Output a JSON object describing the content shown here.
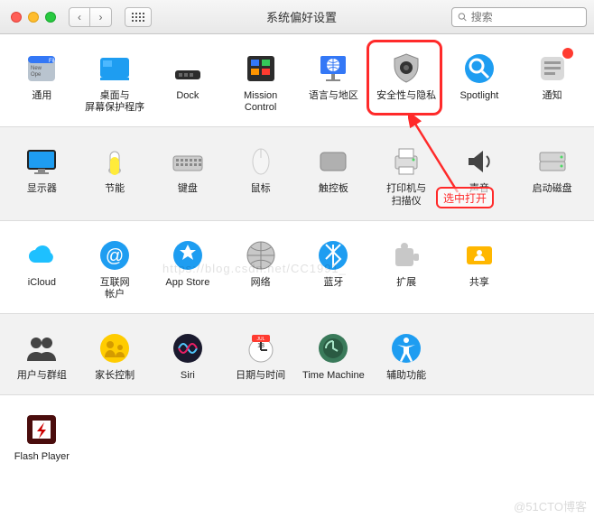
{
  "window": {
    "title": "系统偏好设置"
  },
  "search": {
    "placeholder": "搜索"
  },
  "annotation": {
    "callout": "选中打开"
  },
  "watermarks": {
    "center": "https://blog.csdn.net/CC1991_",
    "bottom": "@51CTO博客"
  },
  "rows": [
    [
      {
        "name": "general",
        "label": "通用",
        "icon": "general"
      },
      {
        "name": "desktop",
        "label": "桌面与\n屏幕保护程序",
        "icon": "desktop"
      },
      {
        "name": "dock",
        "label": "Dock",
        "icon": "dock"
      },
      {
        "name": "mission",
        "label": "Mission\nControl",
        "icon": "mission"
      },
      {
        "name": "language",
        "label": "语言与地区",
        "icon": "language"
      },
      {
        "name": "security",
        "label": "安全性与隐私",
        "icon": "security"
      },
      {
        "name": "spotlight",
        "label": "Spotlight",
        "icon": "spotlight"
      },
      {
        "name": "notifications",
        "label": "通知",
        "icon": "notifications",
        "badge": true
      }
    ],
    [
      {
        "name": "displays",
        "label": "显示器",
        "icon": "displays"
      },
      {
        "name": "energy",
        "label": "节能",
        "icon": "energy"
      },
      {
        "name": "keyboard",
        "label": "键盘",
        "icon": "keyboard"
      },
      {
        "name": "mouse",
        "label": "鼠标",
        "icon": "mouse"
      },
      {
        "name": "trackpad",
        "label": "触控板",
        "icon": "trackpad"
      },
      {
        "name": "printers",
        "label": "打印机与\n扫描仪",
        "icon": "printers"
      },
      {
        "name": "sound",
        "label": "声音",
        "icon": "sound"
      },
      {
        "name": "startup",
        "label": "启动磁盘",
        "icon": "startup"
      }
    ],
    [
      {
        "name": "icloud",
        "label": "iCloud",
        "icon": "icloud"
      },
      {
        "name": "internet",
        "label": "互联网\n帐户",
        "icon": "internet"
      },
      {
        "name": "appstore",
        "label": "App Store",
        "icon": "appstore"
      },
      {
        "name": "network",
        "label": "网络",
        "icon": "network"
      },
      {
        "name": "bluetooth",
        "label": "蓝牙",
        "icon": "bluetooth"
      },
      {
        "name": "extensions",
        "label": "扩展",
        "icon": "extensions"
      },
      {
        "name": "sharing",
        "label": "共享",
        "icon": "sharing"
      }
    ],
    [
      {
        "name": "users",
        "label": "用户与群组",
        "icon": "users"
      },
      {
        "name": "parental",
        "label": "家长控制",
        "icon": "parental"
      },
      {
        "name": "siri",
        "label": "Siri",
        "icon": "siri"
      },
      {
        "name": "datetime",
        "label": "日期与时间",
        "icon": "datetime"
      },
      {
        "name": "timemachine",
        "label": "Time Machine",
        "icon": "timemachine"
      },
      {
        "name": "accessibility",
        "label": "辅助功能",
        "icon": "accessibility"
      }
    ],
    [
      {
        "name": "flash",
        "label": "Flash Player",
        "icon": "flash"
      }
    ]
  ]
}
